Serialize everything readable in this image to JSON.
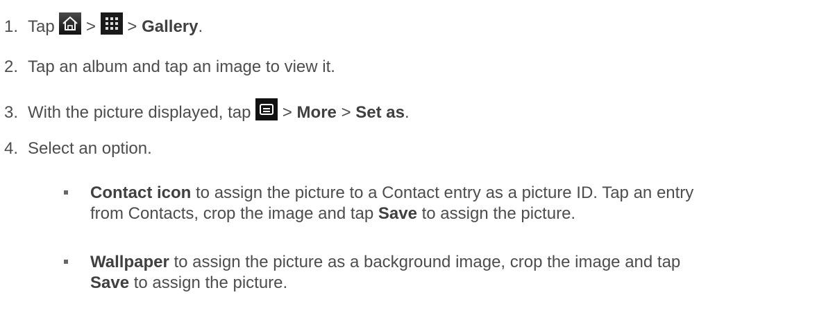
{
  "steps": [
    {
      "num": "1.",
      "t1": "Tap",
      "sep1": ">",
      "sep2": ">",
      "gallery": "Gallery",
      "end": "."
    },
    {
      "num": "2.",
      "text": "Tap an album and tap an image to view it."
    },
    {
      "num": "3.",
      "t1": "With the picture displayed, tap",
      "sep1": ">",
      "more": "More",
      "sep2": ">",
      "setas": "Set as",
      "end": "."
    },
    {
      "num": "4.",
      "text": "Select an option."
    }
  ],
  "options": [
    {
      "bold": "Contact icon",
      "text": " to assign the picture to a Contact entry as a picture ID. Tap an entry",
      "line2": "from Contacts, crop the image and tap ",
      "bold2": "Save",
      "end": " to assign the picture."
    },
    {
      "bold": "Wallpaper",
      "text": " to assign the picture as a background image, crop the image and tap",
      "bold2": "Save",
      "end": " to assign the picture."
    }
  ],
  "icons": [
    "home-icon",
    "apps-grid-icon",
    "menu-icon"
  ]
}
